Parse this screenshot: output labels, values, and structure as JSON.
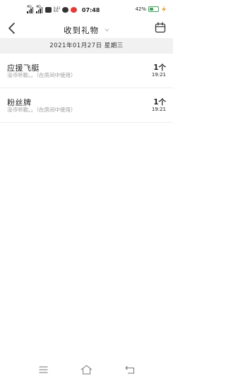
{
  "status_bar": {
    "net1": "4G",
    "net2": "4G",
    "speed_value": "0.43",
    "speed_unit": "K/S",
    "time": "07:48",
    "battery": "42%",
    "battery_level": 0.42
  },
  "header": {
    "title": "收到礼物"
  },
  "date_bar": {
    "text": "2021年01月27日 星期三"
  },
  "gifts": [
    {
      "name": "应援飞艇",
      "desc": "没币听歌。。（在房间中使用）",
      "count": "1个",
      "time": "19:21"
    },
    {
      "name": "粉丝牌",
      "desc": "没币听歌。。（在房间中使用）",
      "count": "1个",
      "time": "19:21"
    }
  ],
  "colors": {
    "date_bar_bg": "#f1f1f1",
    "battery_green": "#3aa35a",
    "secondary_text": "#9a9a9a"
  }
}
